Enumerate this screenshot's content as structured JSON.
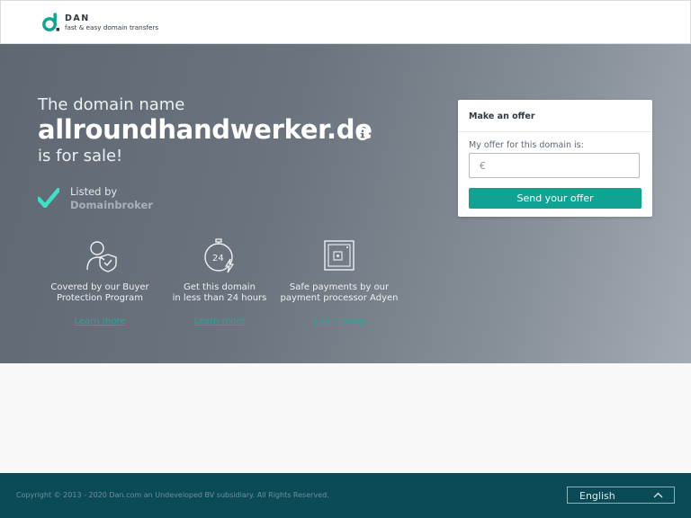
{
  "brand": {
    "name": "DAN",
    "tagline": "fast & easy domain transfers"
  },
  "hero": {
    "pre_title": "The domain name",
    "domain": "allroundhandwerker.de",
    "post_title": "is for sale!",
    "listed_label": "Listed by",
    "listed_value": "Domainbroker"
  },
  "features": [
    {
      "icon": "shield-person-icon",
      "line1": "Covered by our Buyer",
      "line2": "Protection Program",
      "link": "Learn more"
    },
    {
      "icon": "stopwatch-24-icon",
      "line1": "Get this domain",
      "line2": "in less than 24 hours",
      "link": "Learn more"
    },
    {
      "icon": "safe-icon",
      "line1": "Safe payments by our",
      "line2": "payment processor Adyen",
      "link": "Learn more"
    }
  ],
  "offer": {
    "title": "Make an offer",
    "label": "My offer for this domain is:",
    "currency": "€",
    "input_value": "",
    "button": "Send your offer"
  },
  "footer": {
    "copyright": "Copyright © 2013 - 2020 Dan.com an Undeveloped BV subsidiary. All Rights Reserved.",
    "language": "English"
  },
  "colors": {
    "accent": "#11a392",
    "check": "#3fe0c5",
    "footer_bg": "#0b4b57"
  }
}
